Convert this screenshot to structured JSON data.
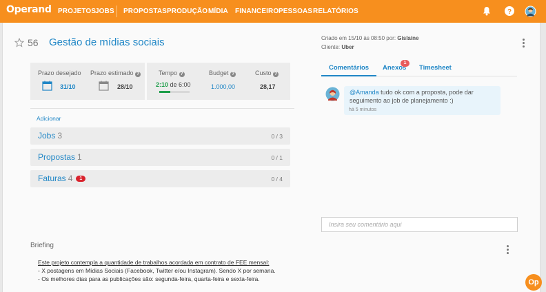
{
  "app": {
    "logo": "Operand"
  },
  "nav": {
    "items": [
      {
        "label": "PROJETOS"
      },
      {
        "label": "JOBS"
      },
      {
        "label": "PROPOSTAS"
      },
      {
        "label": "PRODUÇÃO"
      },
      {
        "label": "MÍDIA"
      },
      {
        "label": "FINANCEIRO"
      },
      {
        "label": "PESSOAS"
      },
      {
        "label": "RELATÓRIOS"
      }
    ],
    "icons": [
      "bell-icon",
      "help-icon",
      "avatar"
    ]
  },
  "project": {
    "number": "56",
    "title": "Gestão de mídias sociais",
    "created_prefix": "Criado em 15/10 às 08:50 por: ",
    "created_by": "Gislaine",
    "client_prefix": "Cliente: ",
    "client": "Uber"
  },
  "stats": {
    "prazo_desejado": {
      "label": "Prazo desejado",
      "value": "31/10"
    },
    "prazo_estimado": {
      "label": "Prazo estimado",
      "value": "28/10"
    },
    "tempo": {
      "label": "Tempo",
      "spent": "2:10",
      "joiner": " de ",
      "total": "6:00",
      "progress": 0.36
    },
    "budget": {
      "label": "Budget",
      "value": "1.000,00"
    },
    "custo": {
      "label": "Custo",
      "value": "28,17"
    }
  },
  "add_link": "Adicionar",
  "sections": [
    {
      "title": "Jobs",
      "count": "3",
      "fraction": "0 / 3",
      "badge": ""
    },
    {
      "title": "Propostas",
      "count": "1",
      "fraction": "0 / 1",
      "badge": ""
    },
    {
      "title": "Faturas",
      "count": "4",
      "fraction": "0 / 4",
      "badge": "1"
    }
  ],
  "tabs": [
    {
      "label": "Comentários",
      "active": true
    },
    {
      "label": "Anexos",
      "badge": "1"
    },
    {
      "label": "Timesheet"
    }
  ],
  "comment": {
    "mention": "@Amanda",
    "text": " tudo ok com a proposta, pode dar seguimento ao job de planejamento :)",
    "time": "há 5 minutos"
  },
  "comment_input": {
    "placeholder": "Insira seu comentário aqui"
  },
  "briefing": {
    "label": "Briefing",
    "lines": [
      "Este projeto contempla a quantidade de trabalhos acordada em contrato de FEE mensal:",
      "- X postagens em Mídias Sociais (Facebook, Twitter e/ou Instagram). Sendo X por semana.",
      "- Os melhores dias para as publicações são: segunda-feira, quarta-feira e sexta-feira."
    ]
  },
  "floating_button": {
    "label": "Op"
  },
  "colors": {
    "brand": "#f78f1e",
    "link": "#1f86c6",
    "alert": "#d9232d",
    "progress": "#1e9e4a"
  }
}
